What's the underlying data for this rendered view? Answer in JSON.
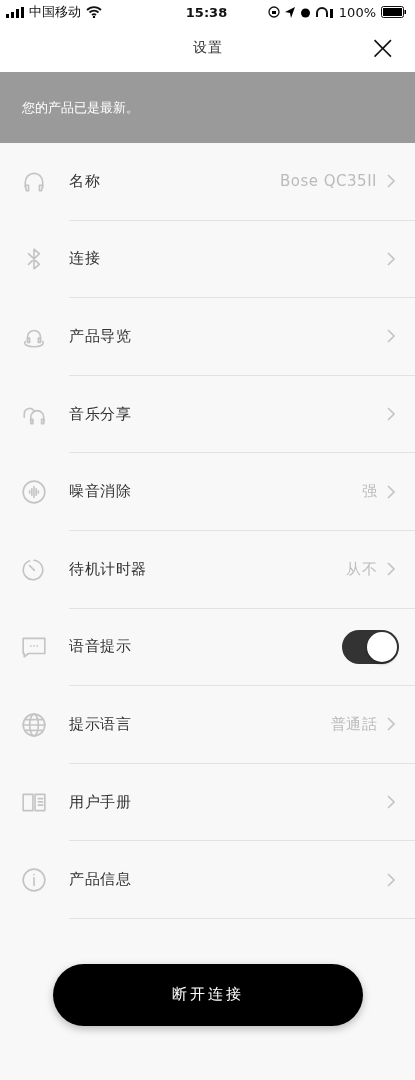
{
  "status_bar": {
    "carrier": "中国移动",
    "time": "15:38",
    "battery": "100%"
  },
  "header": {
    "title": "设置",
    "close": "×"
  },
  "banner": {
    "text": "您的产品已是最新。"
  },
  "settings": [
    {
      "kind": "link",
      "label": "名称",
      "value": "Bose QC35II"
    },
    {
      "kind": "link",
      "label": "连接"
    },
    {
      "kind": "link",
      "label": "产品导览"
    },
    {
      "kind": "link",
      "label": "音乐分享"
    },
    {
      "kind": "link",
      "label": "噪音消除",
      "value": "强"
    },
    {
      "kind": "link",
      "label": "待机计时器",
      "value": "从不"
    },
    {
      "kind": "toggle",
      "label": "语音提示",
      "on": true
    },
    {
      "kind": "link",
      "label": "提示语言",
      "value": "普通話"
    },
    {
      "kind": "link",
      "label": "用户手册"
    },
    {
      "kind": "link",
      "label": "产品信息"
    }
  ],
  "button": {
    "label": "断开连接"
  }
}
